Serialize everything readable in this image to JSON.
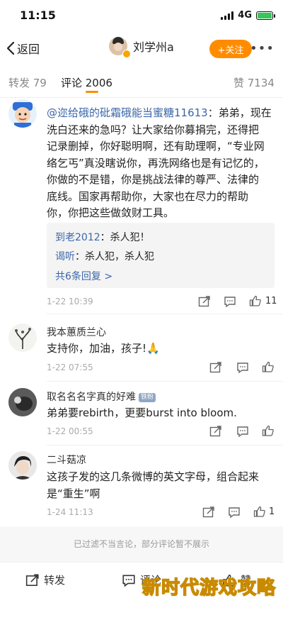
{
  "status": {
    "time": "11:15",
    "network": "4G"
  },
  "nav": {
    "back_label": "返回",
    "user_name": "刘学州a",
    "follow_label": "+关注",
    "more_label": "•••"
  },
  "tabs": {
    "repost": "转发 79",
    "comments": "评论 2006",
    "likes": "赞 7134"
  },
  "comments": [
    {
      "mention": "@迩给硪的砒霜硪能当蜜糖11613",
      "lines": [
        "：弟弟，现在",
        "洗白还来的急吗？让大家给你募捐完，还得把",
        "记录删掉，你好聪明啊，还有助理啊，“专业网",
        "络乞丐”真没瞎说你，再洗网络也是有记忆的，",
        "你做的不是错，你是挑战法律的尊严、法律的",
        "底线。国家再帮助你，大家也在尽力的帮助",
        "你，你把这些做敛财工具。"
      ],
      "replies": [
        {
          "who": "到老2012",
          "text": "：杀人犯！"
        },
        {
          "who": "谒听",
          "text": "：杀人犯，杀人犯"
        }
      ],
      "reply_more": "共6条回复 >",
      "time": "1-22 10:39",
      "likes": "11"
    },
    {
      "name": "我本蕙质兰心",
      "text": "支持你，加油，孩子!🙏",
      "time": "1-22 07:55"
    },
    {
      "name": "取名名名字真的好难",
      "badge": "铁粉",
      "text": "弟弟要rebirth，更要burst into bloom.",
      "time": "1-22 00:55"
    },
    {
      "name": "二斗菇凉",
      "lines": [
        "这孩子发的这几条微博的英文字母，组合起来",
        "是“重生”啊"
      ],
      "time": "1-24 11:13",
      "likes": "1"
    }
  ],
  "footer_note": "已过滤不当言论，部分评论暂不展示",
  "bottom": {
    "repost": "转发",
    "comment": "评论",
    "like": "赞"
  },
  "watermark": "新时代游戏攻略",
  "colors": {
    "accent": "#ff8c00",
    "link": "#3b66a8"
  }
}
